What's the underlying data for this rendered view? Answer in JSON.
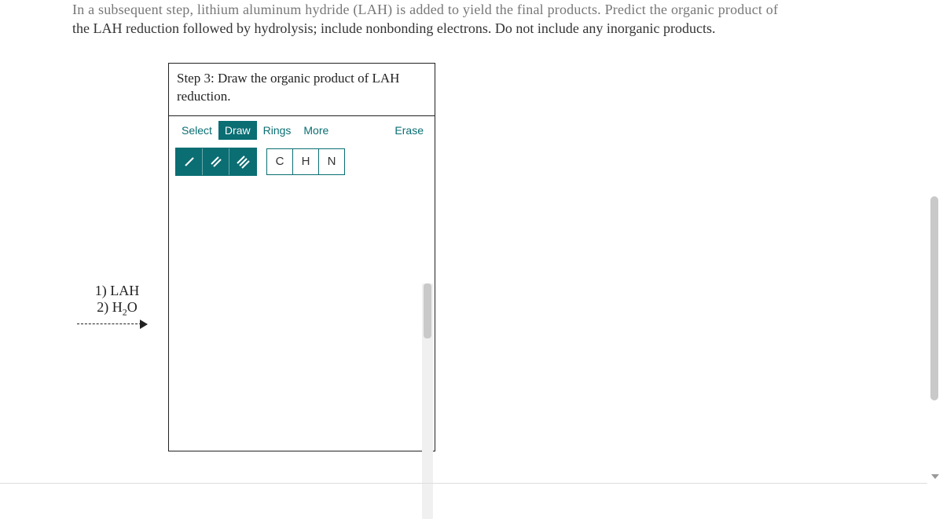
{
  "question": {
    "line1": "In a subsequent step, lithium aluminum hydride (LAH) is added to yield the final products. Predict the organic product of",
    "line2": "the LAH reduction followed by hydrolysis; include nonbonding electrons. Do not include any inorganic products."
  },
  "reagents": {
    "line1": "1) LAH",
    "line2_pre": "2) H",
    "line2_sub": "2",
    "line2_post": "O"
  },
  "drawbox": {
    "step_title": "Step 3: Draw the organic product of LAH reduction.",
    "tabs": {
      "select": "Select",
      "draw": "Draw",
      "rings": "Rings",
      "more": "More"
    },
    "erase": "Erase",
    "bonds": {
      "single": "/",
      "double": "//",
      "triple": "///"
    },
    "atoms": {
      "c": "C",
      "h": "H",
      "n": "N"
    }
  }
}
